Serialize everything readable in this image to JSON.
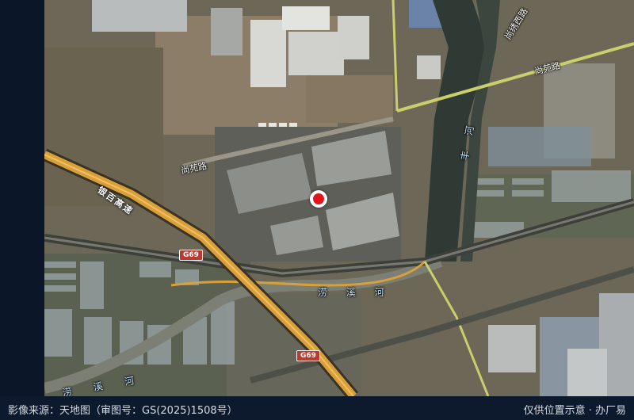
{
  "map": {
    "roads": {
      "shangyuan_north": "尚苑路",
      "shangyuan_west": "尚苑路",
      "shangxiu_west": "尚绣西路"
    },
    "highway": {
      "name": "银百高速",
      "shield_1": "G69",
      "shield_2": "G69"
    },
    "rivers": {
      "canal": "丰 河",
      "main": "涝 溪 河",
      "bottom": "涝 溪 河"
    },
    "colors": {
      "marker": "#e3141c",
      "highway": "#d9a03a",
      "road_edge": "#c9cf6a",
      "shield": "#b93a2f"
    },
    "marker_icon": "location-pin-icon"
  },
  "footer": {
    "source": "影像来源：天地图（审图号：GS(2025)1508号）",
    "note": "仅供位置示意 · 办厂易"
  }
}
